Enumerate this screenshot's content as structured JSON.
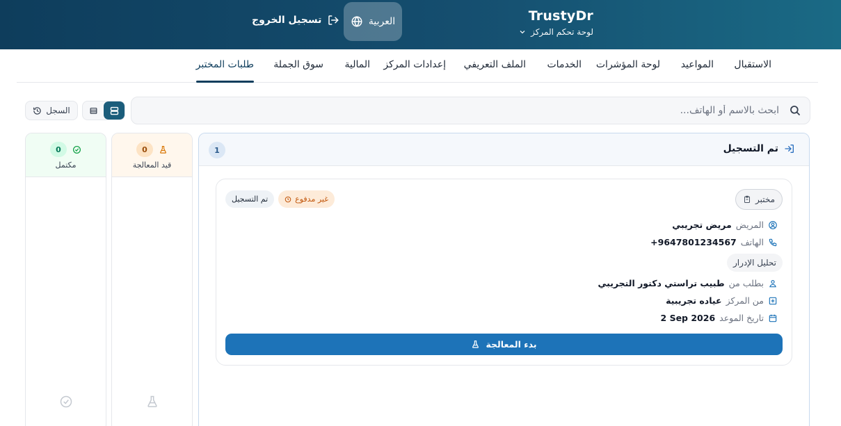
{
  "header": {
    "brand_name": "TrustyDr",
    "subtitle": "لوحة تحكم المركز",
    "language": "العربية",
    "logout": "تسجيل الخروج"
  },
  "tabs": [
    {
      "label": "الاستقبال"
    },
    {
      "label": "المواعيد"
    },
    {
      "label": "لوحة المؤشرات"
    },
    {
      "label": "الخدمات"
    },
    {
      "label": "الملف التعريفي"
    },
    {
      "label": "إعدادات المركز"
    },
    {
      "label": "المالية"
    },
    {
      "label": "سوق الجملة"
    },
    {
      "label": "طلبات المختبر",
      "active": true
    }
  ],
  "toolbar": {
    "search_placeholder": "ابحث بالاسم أو الهاتف...",
    "history_label": "السجل"
  },
  "columns": {
    "registered": {
      "title": "تم التسجيل",
      "count": "1"
    },
    "processing": {
      "title": "قيد المعالجة",
      "count": "0"
    },
    "completed": {
      "title": "مكتمل",
      "count": "0"
    }
  },
  "card": {
    "type": "مختبر",
    "status_registered": "تم التسجيل",
    "status_payment": "غير مدفوع",
    "patient_label": "المريض",
    "patient_name": "مريض تجريبي",
    "phone_label": "الهاتف",
    "phone": "+9647801234567",
    "test": "تحليل الإدرار",
    "requested_by_label": "بطلب من",
    "requested_by": "طبيب تراستي دكتور التجريبي",
    "center_label": "من المركز",
    "center": "عياده تجريبية",
    "date_label": "تاريخ الموعد",
    "date": "2 Sep 2026",
    "action": "بدء المعالجة"
  },
  "colors": {
    "header_start": "#0e3d5c",
    "header_end": "#1a6a85",
    "primary_button": "#1d73b8",
    "unpaid_bg": "#fdebd9",
    "processing_bg": "#fff7ed",
    "completed_bg": "#f0fdf4"
  }
}
